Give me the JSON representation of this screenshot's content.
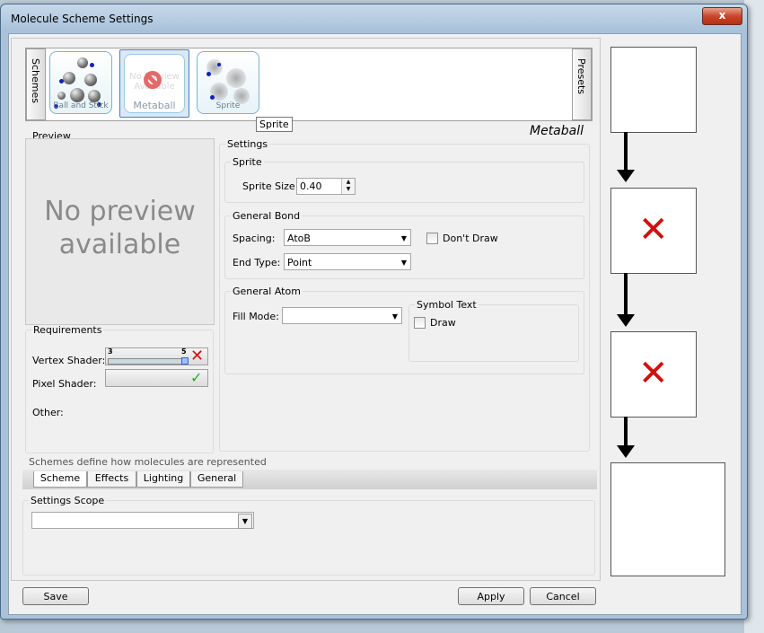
{
  "window": {
    "title": "Molecule Scheme Settings",
    "close": "x"
  },
  "strip": {
    "left_tab": "Schemes",
    "right_tab": "Presets",
    "thumbs": [
      {
        "label": "Ball and Stick"
      },
      {
        "label": "Metaball",
        "overlay": "No Preview Available"
      },
      {
        "label": "Sprite"
      }
    ],
    "tooltip": "Sprite"
  },
  "scheme_name": "Metaball",
  "preview": {
    "legend": "Preview",
    "text": "No preview available"
  },
  "requirements": {
    "legend": "Requirements",
    "vertex_label": "Vertex Shader:",
    "vertex_min": "3",
    "vertex_max": "5",
    "pixel_label": "Pixel Shader:",
    "other_label": "Other:"
  },
  "settings": {
    "legend": "Settings",
    "sprite": {
      "legend": "Sprite",
      "size_label": "Sprite Size:",
      "size_value": "0.40"
    },
    "bond": {
      "legend": "General Bond",
      "spacing_label": "Spacing:",
      "spacing_value": "AtoB",
      "dont_draw_label": "Don't Draw",
      "end_type_label": "End Type:",
      "end_type_value": "Point"
    },
    "atom": {
      "legend": "General Atom",
      "fill_label": "Fill Mode:",
      "fill_value": "",
      "symbol_legend": "Symbol Text",
      "draw_label": "Draw"
    }
  },
  "description": "Schemes define how molecules are represented",
  "tabs": [
    "Scheme",
    "Effects",
    "Lighting",
    "General"
  ],
  "scope": {
    "legend": "Settings Scope",
    "value": ""
  },
  "buttons": {
    "save": "Save",
    "apply": "Apply",
    "cancel": "Cancel"
  }
}
